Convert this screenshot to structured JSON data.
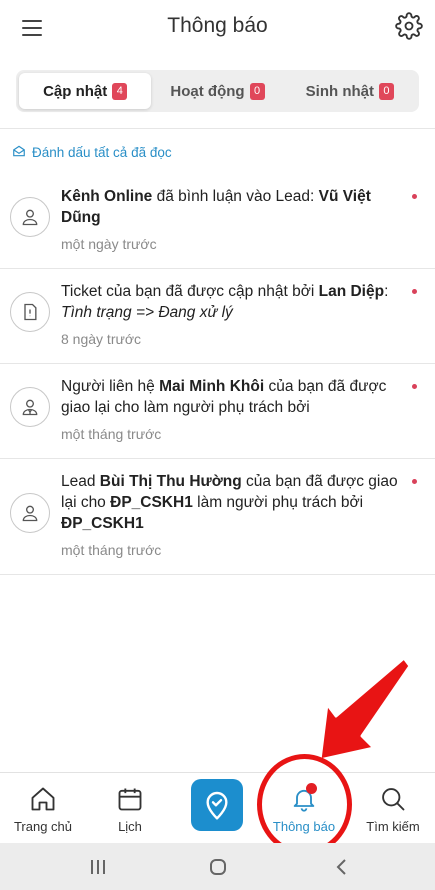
{
  "header": {
    "title": "Thông báo"
  },
  "tabs": [
    {
      "label": "Cập nhật",
      "count": "4"
    },
    {
      "label": "Hoạt động",
      "count": "0"
    },
    {
      "label": "Sinh nhật",
      "count": "0"
    }
  ],
  "mark_all_label": "Đánh dấu tất cả đã đọc",
  "notifications": [
    {
      "icon": "user-icon",
      "parts": [
        {
          "t": "Kênh Online",
          "s": "b"
        },
        {
          "t": " đã bình luận vào Lead: ",
          "s": ""
        },
        {
          "t": "Vũ Việt Dũng",
          "s": "b"
        }
      ],
      "time": "một ngày trước"
    },
    {
      "icon": "ticket-icon",
      "parts": [
        {
          "t": "Ticket  của bạn đã được cập nhật bởi ",
          "s": ""
        },
        {
          "t": "Lan Diệp",
          "s": "b"
        },
        {
          "t": ": ",
          "s": ""
        },
        {
          "t": "Tình trạng => Đang xử lý",
          "s": "i"
        }
      ],
      "time": "8 ngày trước"
    },
    {
      "icon": "contact-icon",
      "parts": [
        {
          "t": "Người liên hệ ",
          "s": ""
        },
        {
          "t": "Mai Minh Khôi",
          "s": "b"
        },
        {
          "t": " của bạn đã được giao lại cho  làm người phụ trách bởi",
          "s": ""
        }
      ],
      "time": "một tháng trước"
    },
    {
      "icon": "user-icon",
      "parts": [
        {
          "t": "Lead ",
          "s": ""
        },
        {
          "t": "Bùi Thị Thu Hường",
          "s": "b"
        },
        {
          "t": " của bạn đã được giao lại cho ",
          "s": ""
        },
        {
          "t": "ĐP_CSKH1",
          "s": "b"
        },
        {
          "t": " làm người phụ trách bởi ",
          "s": ""
        },
        {
          "t": "ĐP_CSKH1",
          "s": "b"
        }
      ],
      "time": "một tháng trước"
    }
  ],
  "bottom_nav": {
    "home": "Trang chủ",
    "calendar": "Lịch",
    "notifications": "Thông báo",
    "search": "Tìm kiếm"
  },
  "colors": {
    "accent": "#2a8fc7",
    "fab": "#1c8ece",
    "badge": "#e0475a",
    "annotation": "#e81414"
  }
}
